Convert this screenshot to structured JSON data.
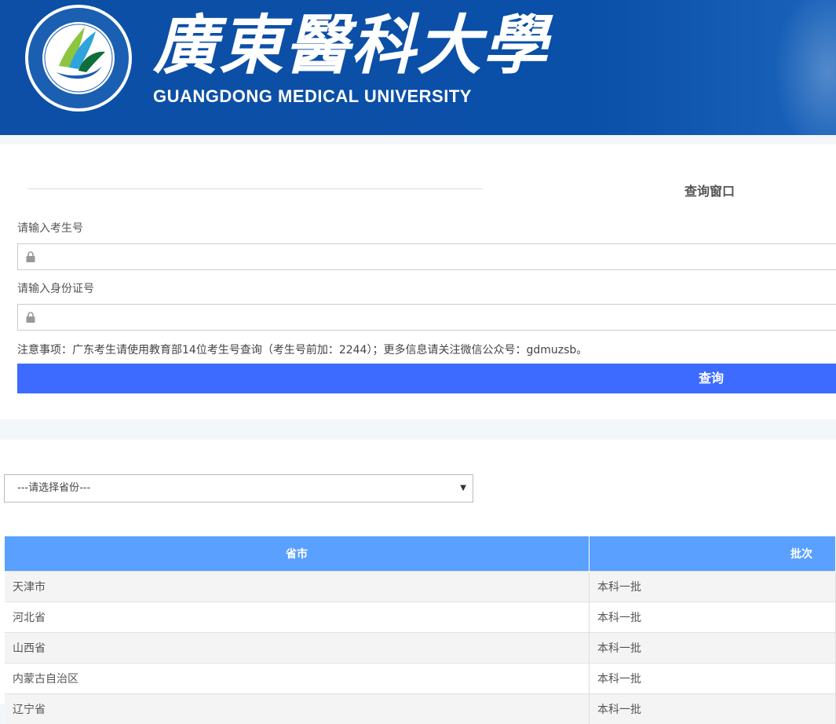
{
  "header": {
    "logo_cn": "廣東醫科大學",
    "logo_en": "GUANGDONG MEDICAL UNIVERSITY",
    "seal_text": "GUANGDONG MEDICAL UNIVERSITY"
  },
  "query": {
    "title": "查询窗口",
    "exam_label": "请输入考生号",
    "exam_value": "",
    "id_label": "请输入身份证号",
    "id_value": "",
    "notice": "注意事项：广东考生请使用教育部14位考生号查询（考生号前加：2244）；更多信息请关注微信公众号：gdmuzsb。",
    "submit_label": "查询"
  },
  "province_select": {
    "selected": "---请选择省份---"
  },
  "table": {
    "headers": [
      "省市",
      "批次"
    ],
    "rows": [
      [
        "天津市",
        "本科一批"
      ],
      [
        "河北省",
        "本科一批"
      ],
      [
        "山西省",
        "本科一批"
      ],
      [
        "内蒙古自治区",
        "本科一批"
      ],
      [
        "辽宁省",
        "本科一批"
      ]
    ]
  },
  "colors": {
    "banner": "#0d4fa6",
    "submit": "#3d6bff",
    "table_header": "#5aa0ff"
  },
  "icons": [
    "lock-icon",
    "university-seal-logo",
    "dropdown-caret-icon"
  ]
}
